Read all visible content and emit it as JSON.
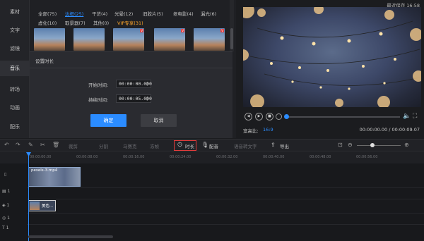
{
  "nav": {
    "items": [
      "素材",
      "文字",
      "滤镜",
      "音乐",
      "转场",
      "动画",
      "配乐"
    ],
    "active_index": 3
  },
  "media": {
    "filters_row1": [
      "全部(75)",
      "边框(25)",
      "干货(4)",
      "光晕(12)",
      "旧胶片(5)",
      "老电影(4)",
      "漏光(6)"
    ],
    "filters_row2": [
      "虚化(10)",
      "取景器(7)",
      "其他(0)",
      "VIP专享(31)"
    ],
    "active_filter": "边框(25)"
  },
  "dialog": {
    "title": "设置时长",
    "start_label": "开始时间:",
    "start_value": "00:00:00.000",
    "duration_label": "持续时间:",
    "duration_value": "00:00:05.000",
    "ok_label": "确定",
    "cancel_label": "取消"
  },
  "preview": {
    "last_saved": "最近保存 16:58",
    "aspect_label": "宽高比:",
    "aspect_value": "16:9",
    "timecode": "00:00:00.00 / 00:00:09.07",
    "progress": 0.0
  },
  "toolbar": {
    "crop": "裁剪",
    "mosaic": "马赛克",
    "freeze": "冻帧",
    "speed": "变速",
    "split": "分割",
    "duration": "时长",
    "dub": "配音",
    "speech_to_text": "语音转文字",
    "export": "导出",
    "zoom_level": 0.35
  },
  "timeline": {
    "ticks": [
      "00:00:00.00",
      "00:00:08.00",
      "00:00:16.00",
      "00:00:24.00",
      "00:00:32.00",
      "00:00:40.00",
      "00:00:48.00",
      "00:00:56.00"
    ],
    "video_clip": "pexels-3.mp4",
    "text_clip": "美色...",
    "track_labels": [
      "1",
      "1",
      "1",
      "1",
      "1"
    ]
  }
}
